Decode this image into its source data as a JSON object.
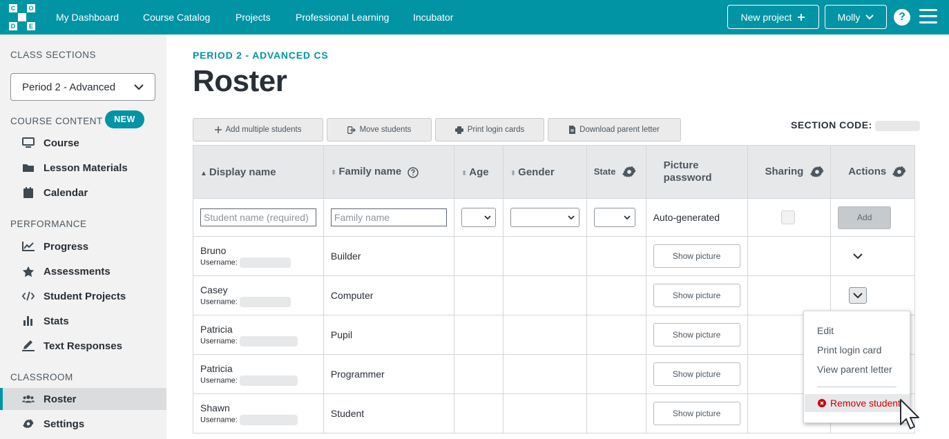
{
  "topbar": {
    "logo_letters": [
      "C",
      "O",
      "D",
      "E"
    ],
    "nav": [
      "My Dashboard",
      "Course Catalog",
      "Projects",
      "Professional Learning",
      "Incubator"
    ],
    "new_project": "New project",
    "user": "Molly",
    "help": "?"
  },
  "sidebar": {
    "class_sections_heading": "CLASS SECTIONS",
    "section_select": "Period 2 - Advanced",
    "course_content_heading": "COURSE CONTENT",
    "new_badge": "NEW",
    "course_items": [
      "Course",
      "Lesson Materials",
      "Calendar"
    ],
    "performance_heading": "PERFORMANCE",
    "performance_items": [
      "Progress",
      "Assessments",
      "Student Projects",
      "Stats",
      "Text Responses"
    ],
    "classroom_heading": "CLASSROOM",
    "classroom_items": [
      "Roster",
      "Settings"
    ]
  },
  "page": {
    "breadcrumb": "PERIOD 2 - ADVANCED CS",
    "title": "Roster",
    "section_code_label": "SECTION CODE:"
  },
  "toolbar": {
    "add_multiple": "Add multiple students",
    "move": "Move students",
    "print": "Print login cards",
    "download": "Download parent letter"
  },
  "table": {
    "headers": {
      "display": "Display name",
      "family": "Family name",
      "age": "Age",
      "gender": "Gender",
      "state": "State",
      "picture1": "Picture",
      "picture2": "password",
      "sharing": "Sharing",
      "actions": "Actions"
    },
    "add_row": {
      "name_placeholder": "Student name (required)",
      "family_placeholder": "Family name",
      "picture": "Auto-generated",
      "add": "Add"
    },
    "username_label": "Username:",
    "show_picture": "Show picture",
    "students": [
      {
        "name": "Bruno",
        "family": "Builder"
      },
      {
        "name": "Casey",
        "family": "Computer"
      },
      {
        "name": "Patricia",
        "family": "Pupil"
      },
      {
        "name": "Patricia",
        "family": "Programmer"
      },
      {
        "name": "Shawn",
        "family": "Student"
      }
    ]
  },
  "actions_menu": {
    "edit": "Edit",
    "print": "Print login card",
    "view": "View parent letter",
    "remove": "Remove student"
  },
  "colors": {
    "brand": "#0094a5",
    "danger": "#cc0000"
  }
}
